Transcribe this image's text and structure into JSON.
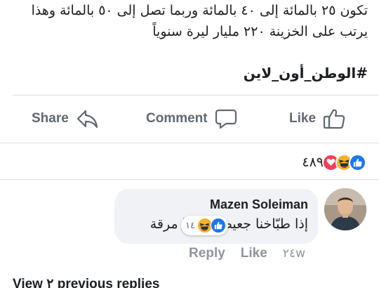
{
  "post": {
    "text_line1": "تكون ٢٥ بالمائة إلى ٤٠ بالمائة وربما تصل إلى ٥٠ بالمائة وهذا",
    "text_line2": "يرتب على الخزينة ٢٢٠ مليار ليرة سنوياً",
    "hashtag": "#الوطن_أون_لاين"
  },
  "actions": {
    "share_label": "Share",
    "comment_label": "Comment",
    "like_label": "Like"
  },
  "reactions": {
    "count": "٤٨٩",
    "icons": [
      "like-icon",
      "haha-icon",
      "love-icon"
    ],
    "colors": {
      "like": "#1877f2",
      "haha": "#f7b125",
      "love": "#f33e58"
    }
  },
  "comment": {
    "author": "Mazen Soleiman",
    "text": "إذا طبّاخنا جعيص شبعنا مرقة",
    "reaction_count": "١٤",
    "reaction_icons": [
      "like-icon",
      "haha-icon"
    ],
    "time": "٢٤w",
    "like_label": "Like",
    "reply_label": "Reply"
  },
  "replies": {
    "view_label": "View ٢ previous replies"
  }
}
